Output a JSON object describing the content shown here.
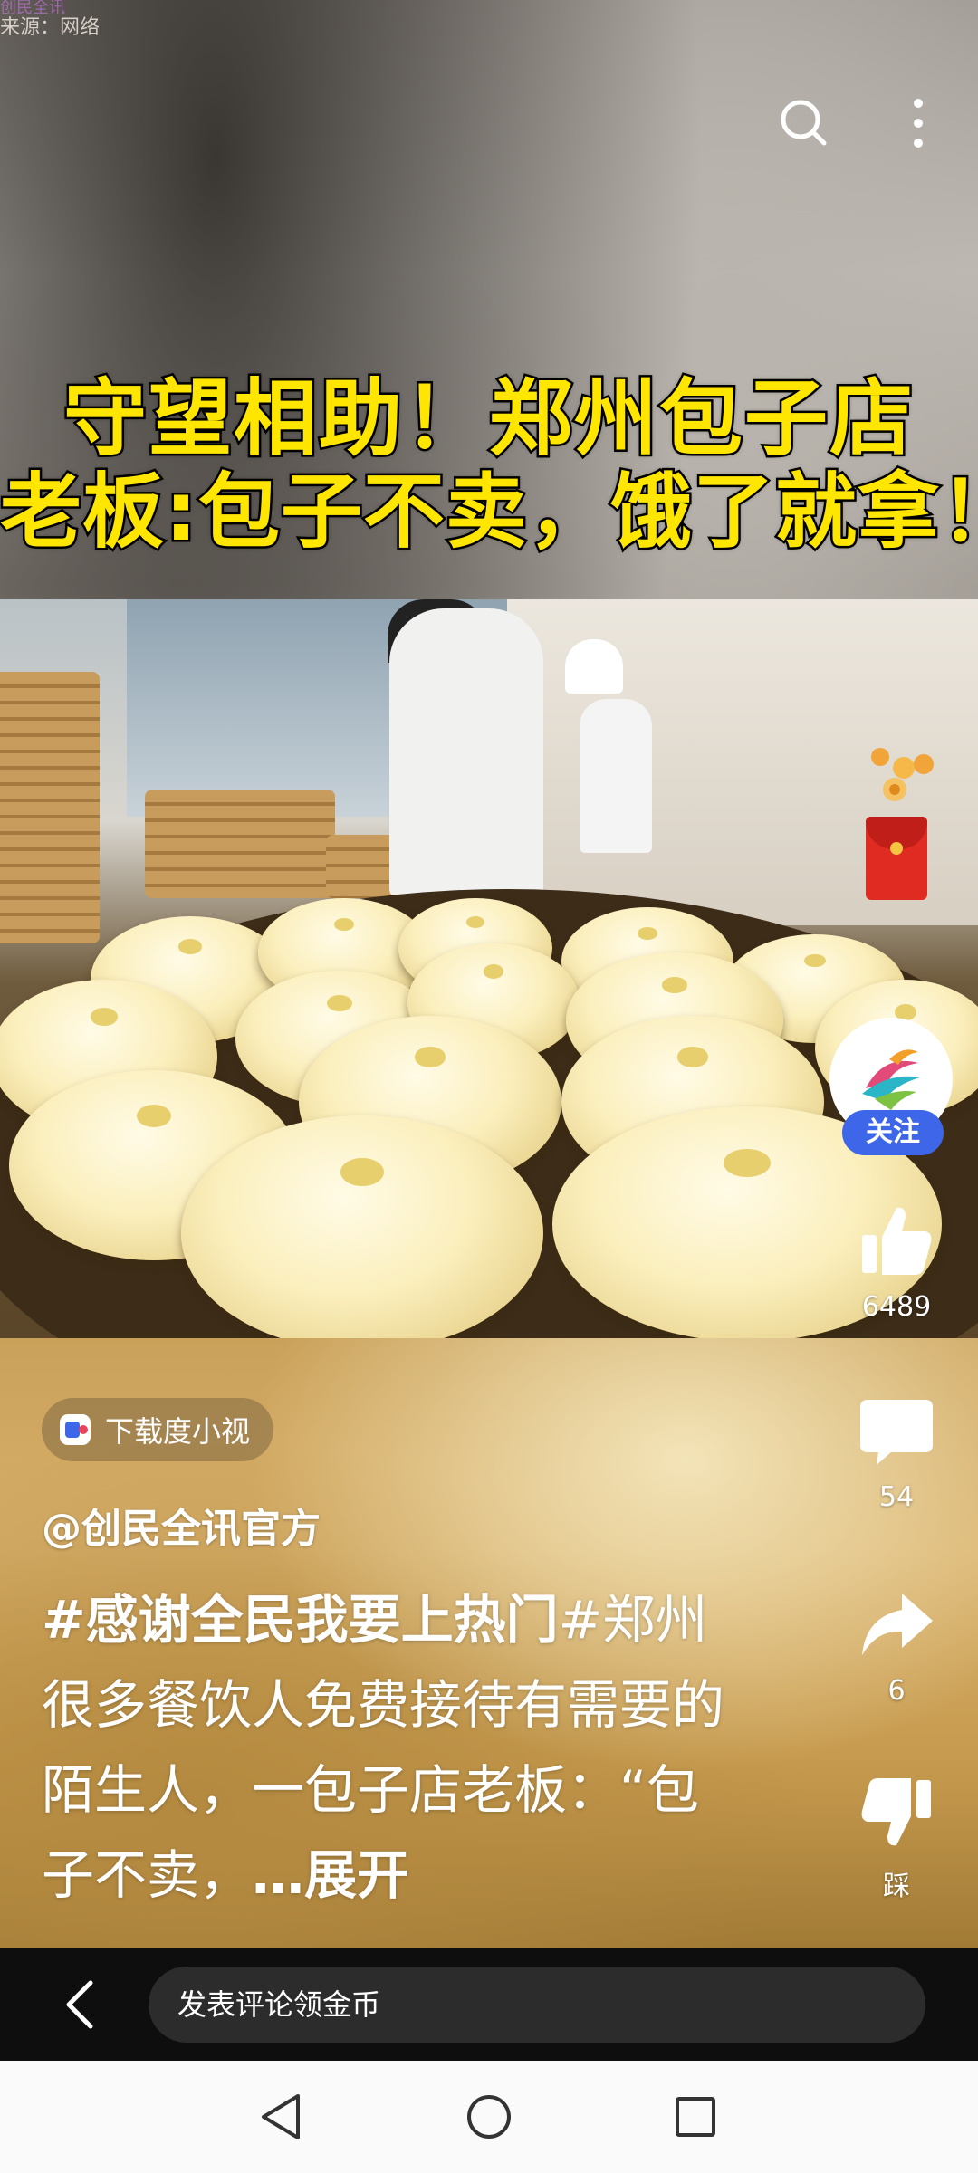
{
  "source": {
    "brand": "创民全讯",
    "label": "来源：网络"
  },
  "video": {
    "headline_line1": "守望相助！郑州包子店",
    "headline_line2": "老板:包子不卖，饿了就拿！"
  },
  "top_actions": {
    "search_icon": "search-icon",
    "more_icon": "more-vertical-icon"
  },
  "side": {
    "follow_label": "关注",
    "like_count": "6489",
    "comment_count": "54",
    "share_count": "6",
    "dislike_label": "踩"
  },
  "post": {
    "download_label": "下载度小视",
    "author": "@创民全讯官方",
    "hashtag1": "#感谢全民我要上热门",
    "desc_tail": "#郑州很多餐饮人免费接待有需要的陌生人，一包子店老板：“包子不卖，",
    "expand": "…展开"
  },
  "comment_bar": {
    "placeholder": "发表评论领金币"
  },
  "colors": {
    "headline_yellow": "#ffe600",
    "follow_blue": "#3d66e8",
    "redpacket": "#e02b23"
  }
}
